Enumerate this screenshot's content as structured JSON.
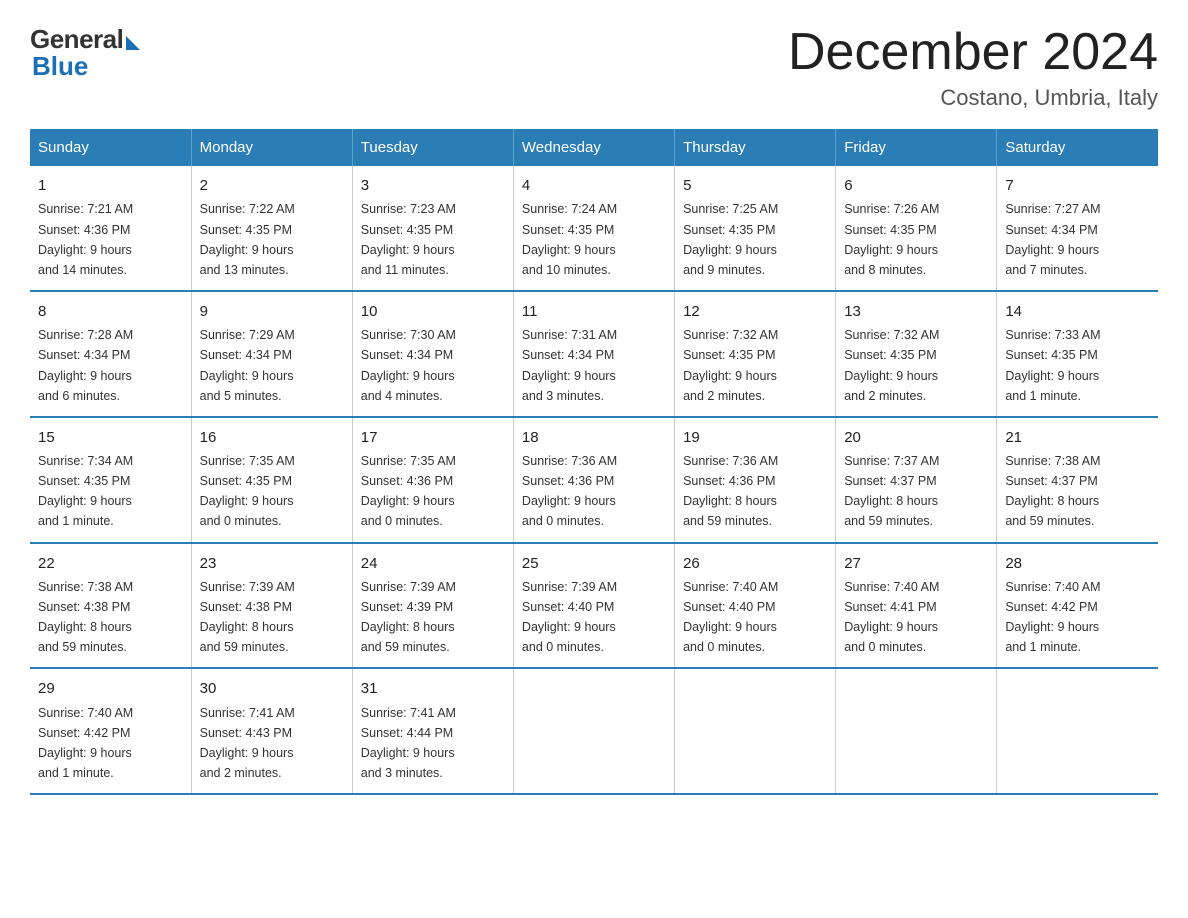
{
  "header": {
    "logo_general": "General",
    "logo_blue": "Blue",
    "month_title": "December 2024",
    "location": "Costano, Umbria, Italy"
  },
  "days_of_week": [
    "Sunday",
    "Monday",
    "Tuesday",
    "Wednesday",
    "Thursday",
    "Friday",
    "Saturday"
  ],
  "weeks": [
    [
      {
        "day": "1",
        "info": "Sunrise: 7:21 AM\nSunset: 4:36 PM\nDaylight: 9 hours\nand 14 minutes."
      },
      {
        "day": "2",
        "info": "Sunrise: 7:22 AM\nSunset: 4:35 PM\nDaylight: 9 hours\nand 13 minutes."
      },
      {
        "day": "3",
        "info": "Sunrise: 7:23 AM\nSunset: 4:35 PM\nDaylight: 9 hours\nand 11 minutes."
      },
      {
        "day": "4",
        "info": "Sunrise: 7:24 AM\nSunset: 4:35 PM\nDaylight: 9 hours\nand 10 minutes."
      },
      {
        "day": "5",
        "info": "Sunrise: 7:25 AM\nSunset: 4:35 PM\nDaylight: 9 hours\nand 9 minutes."
      },
      {
        "day": "6",
        "info": "Sunrise: 7:26 AM\nSunset: 4:35 PM\nDaylight: 9 hours\nand 8 minutes."
      },
      {
        "day": "7",
        "info": "Sunrise: 7:27 AM\nSunset: 4:34 PM\nDaylight: 9 hours\nand 7 minutes."
      }
    ],
    [
      {
        "day": "8",
        "info": "Sunrise: 7:28 AM\nSunset: 4:34 PM\nDaylight: 9 hours\nand 6 minutes."
      },
      {
        "day": "9",
        "info": "Sunrise: 7:29 AM\nSunset: 4:34 PM\nDaylight: 9 hours\nand 5 minutes."
      },
      {
        "day": "10",
        "info": "Sunrise: 7:30 AM\nSunset: 4:34 PM\nDaylight: 9 hours\nand 4 minutes."
      },
      {
        "day": "11",
        "info": "Sunrise: 7:31 AM\nSunset: 4:34 PM\nDaylight: 9 hours\nand 3 minutes."
      },
      {
        "day": "12",
        "info": "Sunrise: 7:32 AM\nSunset: 4:35 PM\nDaylight: 9 hours\nand 2 minutes."
      },
      {
        "day": "13",
        "info": "Sunrise: 7:32 AM\nSunset: 4:35 PM\nDaylight: 9 hours\nand 2 minutes."
      },
      {
        "day": "14",
        "info": "Sunrise: 7:33 AM\nSunset: 4:35 PM\nDaylight: 9 hours\nand 1 minute."
      }
    ],
    [
      {
        "day": "15",
        "info": "Sunrise: 7:34 AM\nSunset: 4:35 PM\nDaylight: 9 hours\nand 1 minute."
      },
      {
        "day": "16",
        "info": "Sunrise: 7:35 AM\nSunset: 4:35 PM\nDaylight: 9 hours\nand 0 minutes."
      },
      {
        "day": "17",
        "info": "Sunrise: 7:35 AM\nSunset: 4:36 PM\nDaylight: 9 hours\nand 0 minutes."
      },
      {
        "day": "18",
        "info": "Sunrise: 7:36 AM\nSunset: 4:36 PM\nDaylight: 9 hours\nand 0 minutes."
      },
      {
        "day": "19",
        "info": "Sunrise: 7:36 AM\nSunset: 4:36 PM\nDaylight: 8 hours\nand 59 minutes."
      },
      {
        "day": "20",
        "info": "Sunrise: 7:37 AM\nSunset: 4:37 PM\nDaylight: 8 hours\nand 59 minutes."
      },
      {
        "day": "21",
        "info": "Sunrise: 7:38 AM\nSunset: 4:37 PM\nDaylight: 8 hours\nand 59 minutes."
      }
    ],
    [
      {
        "day": "22",
        "info": "Sunrise: 7:38 AM\nSunset: 4:38 PM\nDaylight: 8 hours\nand 59 minutes."
      },
      {
        "day": "23",
        "info": "Sunrise: 7:39 AM\nSunset: 4:38 PM\nDaylight: 8 hours\nand 59 minutes."
      },
      {
        "day": "24",
        "info": "Sunrise: 7:39 AM\nSunset: 4:39 PM\nDaylight: 8 hours\nand 59 minutes."
      },
      {
        "day": "25",
        "info": "Sunrise: 7:39 AM\nSunset: 4:40 PM\nDaylight: 9 hours\nand 0 minutes."
      },
      {
        "day": "26",
        "info": "Sunrise: 7:40 AM\nSunset: 4:40 PM\nDaylight: 9 hours\nand 0 minutes."
      },
      {
        "day": "27",
        "info": "Sunrise: 7:40 AM\nSunset: 4:41 PM\nDaylight: 9 hours\nand 0 minutes."
      },
      {
        "day": "28",
        "info": "Sunrise: 7:40 AM\nSunset: 4:42 PM\nDaylight: 9 hours\nand 1 minute."
      }
    ],
    [
      {
        "day": "29",
        "info": "Sunrise: 7:40 AM\nSunset: 4:42 PM\nDaylight: 9 hours\nand 1 minute."
      },
      {
        "day": "30",
        "info": "Sunrise: 7:41 AM\nSunset: 4:43 PM\nDaylight: 9 hours\nand 2 minutes."
      },
      {
        "day": "31",
        "info": "Sunrise: 7:41 AM\nSunset: 4:44 PM\nDaylight: 9 hours\nand 3 minutes."
      },
      {
        "day": "",
        "info": ""
      },
      {
        "day": "",
        "info": ""
      },
      {
        "day": "",
        "info": ""
      },
      {
        "day": "",
        "info": ""
      }
    ]
  ]
}
